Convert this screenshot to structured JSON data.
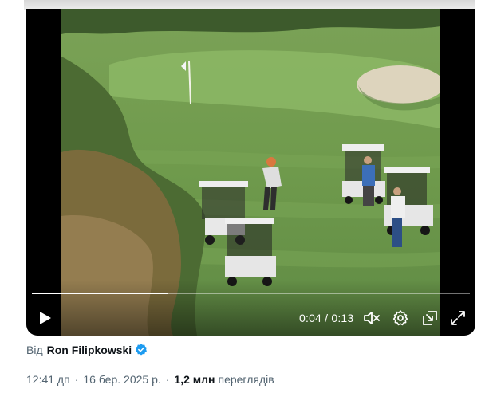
{
  "video": {
    "current_time": "0:04",
    "duration": "0:13",
    "time_separator": "/",
    "progress_fraction": 0.31,
    "icons": {
      "play": "play-icon",
      "volume": "volume-muted-icon",
      "settings": "gear-icon",
      "pip": "picture-in-picture-icon",
      "fullscreen": "fullscreen-icon"
    }
  },
  "author": {
    "prefix": "Від",
    "name": "Ron Filipkowski",
    "verified_icon": "verified-badge-icon"
  },
  "meta": {
    "time": "12:41 дп",
    "date": "16 бер. 2025 р.",
    "separator": "·",
    "views_count": "1,2 млн",
    "views_label": "переглядів"
  },
  "colors": {
    "verified_blue": "#1d9bf0",
    "text_primary": "#0f1419",
    "text_secondary": "#536471"
  }
}
